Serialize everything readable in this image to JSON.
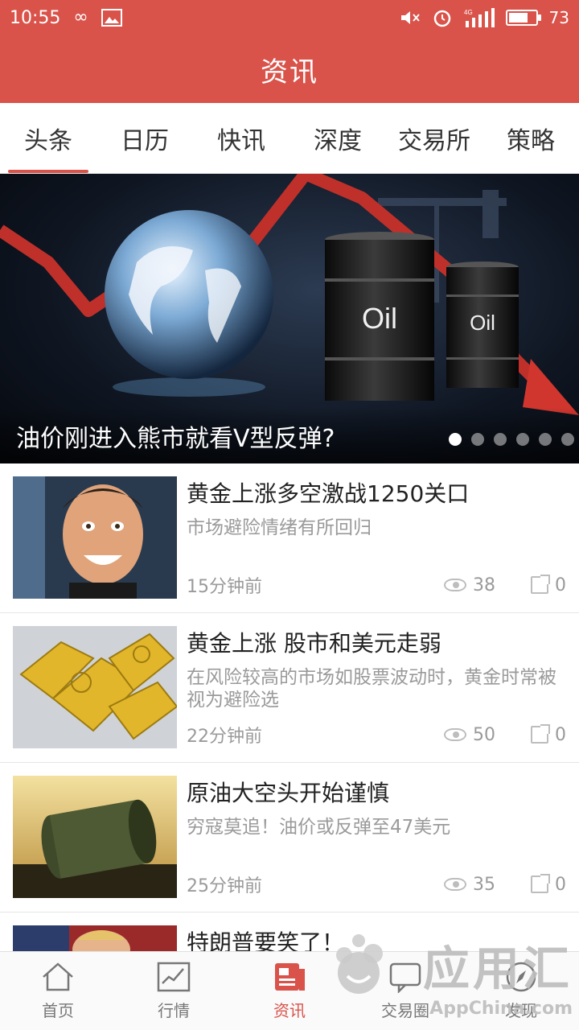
{
  "status_bar": {
    "time": "10:55",
    "battery": "73",
    "battery_level_percent": 73,
    "signal": "4G",
    "icons": [
      "infinity-icon",
      "image-icon",
      "mute-icon",
      "alarm-icon",
      "signal-icon",
      "battery-icon"
    ]
  },
  "header": {
    "title": "资讯"
  },
  "tabs": [
    {
      "label": "头条",
      "active": true
    },
    {
      "label": "日历"
    },
    {
      "label": "快讯"
    },
    {
      "label": "深度"
    },
    {
      "label": "交易所"
    },
    {
      "label": "策略"
    }
  ],
  "banner": {
    "caption": "油价刚进入熊市就看V型反弹?",
    "barrel_label_1": "Oil",
    "barrel_label_2": "Oil",
    "slide_count": 6,
    "active_slide": 1
  },
  "news": [
    {
      "title": "黄金上涨多空激战1250关口",
      "summary": "市场避险情绪有所回归",
      "time": "15分钟前",
      "views": "38",
      "shares": "0"
    },
    {
      "title": "黄金上涨 股市和美元走弱",
      "summary": "在风险较高的市场如股票波动时，黄金时常被视为避险选",
      "time": "22分钟前",
      "views": "50",
      "shares": "0"
    },
    {
      "title": "原油大空头开始谨慎",
      "summary": "穷寇莫追！油价或反弹至47美元",
      "time": "25分钟前",
      "views": "35",
      "shares": "0"
    },
    {
      "title": "特朗普要笑了！",
      "summary": "",
      "time": "",
      "views": "",
      "shares": ""
    }
  ],
  "bottom_nav": [
    {
      "label": "首页",
      "icon": "home-icon"
    },
    {
      "label": "行情",
      "icon": "chart-icon"
    },
    {
      "label": "资讯",
      "icon": "news-icon",
      "active": true
    },
    {
      "label": "交易圈",
      "icon": "chat-icon"
    },
    {
      "label": "发现",
      "icon": "compass-icon"
    }
  ],
  "watermark": {
    "main": "应用汇",
    "sub": "AppChina.com"
  },
  "colors": {
    "brand": "#d9534a",
    "muted": "#9a9a9a"
  }
}
